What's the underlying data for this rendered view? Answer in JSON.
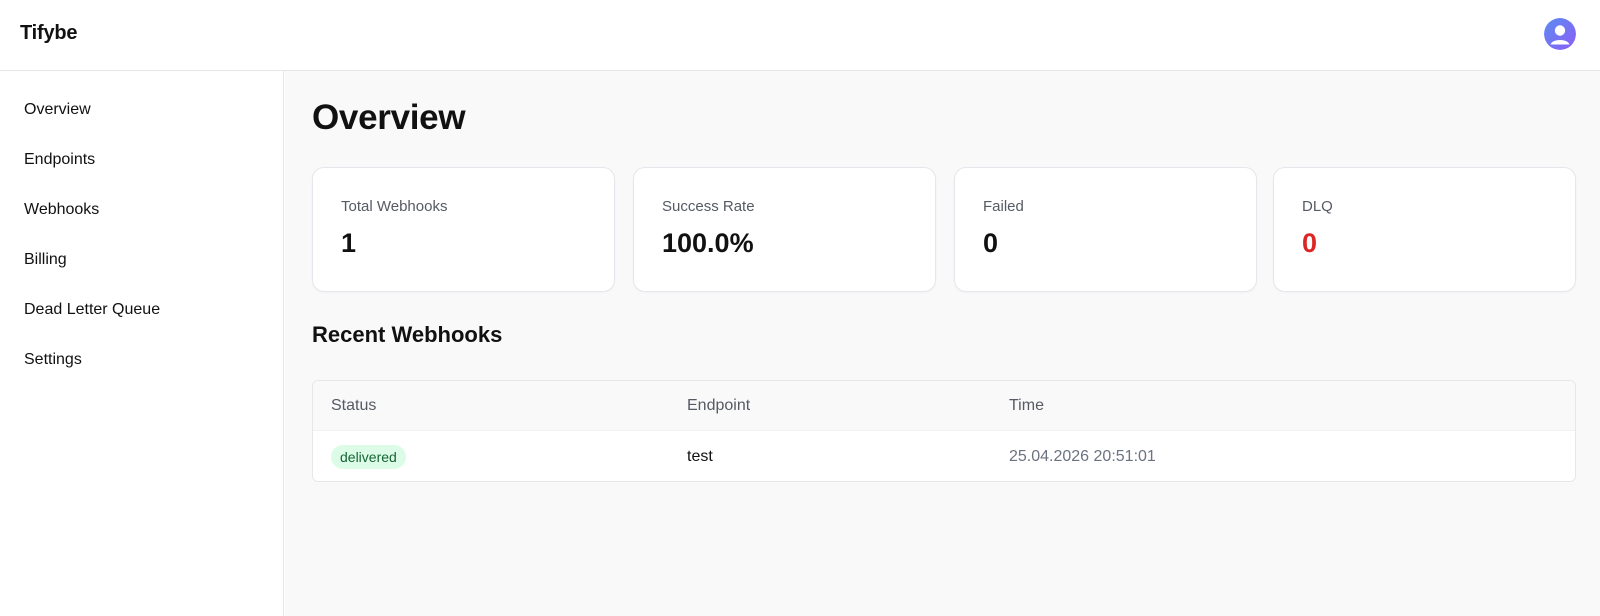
{
  "header": {
    "brand": "Tifybe",
    "avatar_icon": "user-avatar-icon",
    "avatar_color": "#7c6cf0"
  },
  "sidebar": {
    "items": [
      {
        "label": "Overview"
      },
      {
        "label": "Endpoints"
      },
      {
        "label": "Webhooks"
      },
      {
        "label": "Billing"
      },
      {
        "label": "Dead Letter Queue"
      },
      {
        "label": "Settings"
      }
    ]
  },
  "main": {
    "title": "Overview",
    "stats": [
      {
        "label": "Total Webhooks",
        "value": "1"
      },
      {
        "label": "Success Rate",
        "value": "100.0%"
      },
      {
        "label": "Failed",
        "value": "0"
      },
      {
        "label": "DLQ",
        "value": "0",
        "color": "#dc2626"
      }
    ],
    "recent": {
      "title": "Recent Webhooks",
      "columns": [
        "Status",
        "Endpoint",
        "Time"
      ],
      "rows": [
        {
          "status": "delivered",
          "status_color": "#dcfce7",
          "endpoint": "test",
          "time": "25.04.2026 20:51:01"
        }
      ]
    }
  }
}
